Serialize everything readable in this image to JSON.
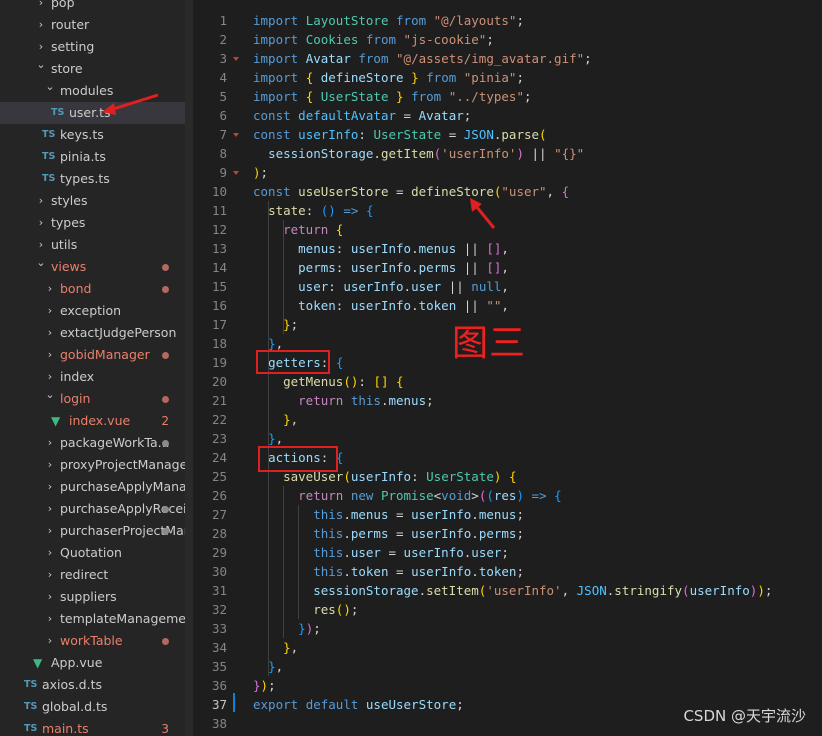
{
  "explorer": {
    "items": [
      {
        "label": "pop",
        "expanded": false,
        "icon": "folder",
        "status": ""
      },
      {
        "label": "router",
        "expanded": false,
        "icon": "folder",
        "status": ""
      },
      {
        "label": "setting",
        "expanded": false,
        "icon": "folder",
        "status": ""
      },
      {
        "label": "store",
        "expanded": true,
        "icon": "folder",
        "status": ""
      },
      {
        "label": "modules",
        "expanded": true,
        "icon": "folder",
        "status": ""
      },
      {
        "label": "user.ts",
        "icon": "ts",
        "badge": "TS",
        "status": "",
        "selected": true
      },
      {
        "label": "keys.ts",
        "icon": "ts",
        "badge": "TS",
        "status": ""
      },
      {
        "label": "pinia.ts",
        "icon": "ts",
        "badge": "TS",
        "status": ""
      },
      {
        "label": "types.ts",
        "icon": "ts",
        "badge": "TS",
        "status": ""
      },
      {
        "label": "styles",
        "expanded": false,
        "icon": "folder",
        "status": ""
      },
      {
        "label": "types",
        "expanded": false,
        "icon": "folder",
        "status": ""
      },
      {
        "label": "utils",
        "expanded": false,
        "icon": "folder",
        "status": ""
      },
      {
        "label": "views",
        "expanded": true,
        "icon": "folder",
        "status": "modified"
      },
      {
        "label": "bond",
        "expanded": false,
        "icon": "folder",
        "status": "modified"
      },
      {
        "label": "exception",
        "expanded": false,
        "icon": "folder",
        "status": ""
      },
      {
        "label": "extactJudgePerson",
        "expanded": false,
        "icon": "folder",
        "status": ""
      },
      {
        "label": "gobidManager",
        "expanded": false,
        "icon": "folder",
        "status": "modified"
      },
      {
        "label": "index",
        "expanded": false,
        "icon": "folder",
        "status": ""
      },
      {
        "label": "login",
        "expanded": true,
        "icon": "folder",
        "status": "modified"
      },
      {
        "label": "index.vue",
        "icon": "vue",
        "status": "error",
        "count": "2"
      },
      {
        "label": "packageWorkTa...",
        "expanded": false,
        "icon": "folder",
        "status": "dot-gray"
      },
      {
        "label": "proxyProjectManage",
        "expanded": false,
        "icon": "folder",
        "status": ""
      },
      {
        "label": "purchaseApplyManage",
        "expanded": false,
        "icon": "folder",
        "status": ""
      },
      {
        "label": "purchaseApplyReceiv...",
        "expanded": false,
        "icon": "folder",
        "status": "dot-gray"
      },
      {
        "label": "purchaserProjectMan...",
        "expanded": false,
        "icon": "folder",
        "status": "dot-gray"
      },
      {
        "label": "Quotation",
        "expanded": false,
        "icon": "folder",
        "status": ""
      },
      {
        "label": "redirect",
        "expanded": false,
        "icon": "folder",
        "status": ""
      },
      {
        "label": "suppliers",
        "expanded": false,
        "icon": "folder",
        "status": ""
      },
      {
        "label": "templateManagement",
        "expanded": false,
        "icon": "folder",
        "status": ""
      },
      {
        "label": "workTable",
        "expanded": false,
        "icon": "folder",
        "status": "modified"
      },
      {
        "label": "App.vue",
        "icon": "vue",
        "status": ""
      },
      {
        "label": "axios.d.ts",
        "icon": "ts",
        "badge": "TS",
        "status": ""
      },
      {
        "label": "global.d.ts",
        "icon": "ts",
        "badge": "TS",
        "status": ""
      },
      {
        "label": "main.ts",
        "icon": "ts",
        "badge": "TS",
        "status": "error",
        "count": "3"
      }
    ]
  },
  "editor": {
    "active_line": "37",
    "line_numbers": [
      "1",
      "2",
      "3",
      "4",
      "5",
      "6",
      "7",
      "8",
      "9",
      "10",
      "11",
      "12",
      "13",
      "14",
      "15",
      "16",
      "17",
      "18",
      "19",
      "20",
      "21",
      "22",
      "23",
      "24",
      "25",
      "26",
      "27",
      "28",
      "29",
      "30",
      "31",
      "32",
      "33",
      "34",
      "35",
      "36",
      "37",
      "38"
    ],
    "lines": [
      [
        [
          "k",
          "import"
        ],
        [
          "p",
          " "
        ],
        [
          "t",
          "LayoutStore"
        ],
        [
          "p",
          " "
        ],
        [
          "k",
          "from"
        ],
        [
          "p",
          " "
        ],
        [
          "s",
          "\"@/layouts\""
        ],
        [
          "p",
          ";"
        ]
      ],
      [
        [
          "k",
          "import"
        ],
        [
          "p",
          " "
        ],
        [
          "t",
          "Cookies"
        ],
        [
          "p",
          " "
        ],
        [
          "k",
          "from"
        ],
        [
          "p",
          " "
        ],
        [
          "s",
          "\"js-cookie\""
        ],
        [
          "p",
          ";"
        ]
      ],
      [
        [
          "k",
          "import"
        ],
        [
          "p",
          " "
        ],
        [
          "v",
          "Avatar"
        ],
        [
          "p",
          " "
        ],
        [
          "k",
          "from"
        ],
        [
          "p",
          " "
        ],
        [
          "s",
          "\"@/assets/img_avatar.gif\""
        ],
        [
          "p",
          ";"
        ]
      ],
      [
        [
          "k",
          "import"
        ],
        [
          "p",
          " "
        ],
        [
          "b1",
          "{"
        ],
        [
          "p",
          " "
        ],
        [
          "v",
          "defineStore"
        ],
        [
          "p",
          " "
        ],
        [
          "b1",
          "}"
        ],
        [
          "p",
          " "
        ],
        [
          "k",
          "from"
        ],
        [
          "p",
          " "
        ],
        [
          "s",
          "\"pinia\""
        ],
        [
          "p",
          ";"
        ]
      ],
      [
        [
          "k",
          "import"
        ],
        [
          "p",
          " "
        ],
        [
          "b1",
          "{"
        ],
        [
          "p",
          " "
        ],
        [
          "t",
          "UserState"
        ],
        [
          "p",
          " "
        ],
        [
          "b1",
          "}"
        ],
        [
          "p",
          " "
        ],
        [
          "k",
          "from"
        ],
        [
          "p",
          " "
        ],
        [
          "s",
          "\"../types\""
        ],
        [
          "p",
          ";"
        ]
      ],
      [
        [
          "k",
          "const"
        ],
        [
          "p",
          " "
        ],
        [
          "n",
          "defaultAvatar"
        ],
        [
          "p",
          " = "
        ],
        [
          "v",
          "Avatar"
        ],
        [
          "p",
          ";"
        ]
      ],
      [
        [
          "k",
          "const"
        ],
        [
          "p",
          " "
        ],
        [
          "n",
          "userInfo"
        ],
        [
          "p",
          ": "
        ],
        [
          "t",
          "UserState"
        ],
        [
          "p",
          " = "
        ],
        [
          "n",
          "JSON"
        ],
        [
          "p",
          "."
        ],
        [
          "f",
          "parse"
        ],
        [
          "b1",
          "("
        ]
      ],
      [
        [
          "p",
          "  "
        ],
        [
          "v",
          "sessionStorage"
        ],
        [
          "p",
          "."
        ],
        [
          "f",
          "getItem"
        ],
        [
          "b2",
          "("
        ],
        [
          "s",
          "'userInfo'"
        ],
        [
          "b2",
          ")"
        ],
        [
          "p",
          " || "
        ],
        [
          "s",
          "\"{}\""
        ]
      ],
      [
        [
          "b1",
          ")"
        ],
        [
          "p",
          ";"
        ]
      ],
      [
        [
          "k",
          "const"
        ],
        [
          "p",
          " "
        ],
        [
          "f",
          "useUserStore"
        ],
        [
          "p",
          " = "
        ],
        [
          "f",
          "defineStore"
        ],
        [
          "b1",
          "("
        ],
        [
          "s",
          "\"user\""
        ],
        [
          "p",
          ", "
        ],
        [
          "b2",
          "{"
        ]
      ],
      [
        [
          "p",
          "  "
        ],
        [
          "f",
          "state"
        ],
        [
          "p",
          ": "
        ],
        [
          "b3",
          "("
        ],
        [
          "b3",
          ")"
        ],
        [
          "p",
          " "
        ],
        [
          "k",
          "=>"
        ],
        [
          "p",
          " "
        ],
        [
          "b3",
          "{"
        ]
      ],
      [
        [
          "p",
          "    "
        ],
        [
          "ck",
          "return"
        ],
        [
          "p",
          " "
        ],
        [
          "b1",
          "{"
        ]
      ],
      [
        [
          "p",
          "      "
        ],
        [
          "v",
          "menus"
        ],
        [
          "p",
          ": "
        ],
        [
          "v",
          "userInfo"
        ],
        [
          "p",
          "."
        ],
        [
          "v",
          "menus"
        ],
        [
          "p",
          " || "
        ],
        [
          "b2",
          "[]"
        ],
        [
          "p",
          ","
        ]
      ],
      [
        [
          "p",
          "      "
        ],
        [
          "v",
          "perms"
        ],
        [
          "p",
          ": "
        ],
        [
          "v",
          "userInfo"
        ],
        [
          "p",
          "."
        ],
        [
          "v",
          "perms"
        ],
        [
          "p",
          " || "
        ],
        [
          "b2",
          "[]"
        ],
        [
          "p",
          ","
        ]
      ],
      [
        [
          "p",
          "      "
        ],
        [
          "v",
          "user"
        ],
        [
          "p",
          ": "
        ],
        [
          "v",
          "userInfo"
        ],
        [
          "p",
          "."
        ],
        [
          "v",
          "user"
        ],
        [
          "p",
          " || "
        ],
        [
          "k",
          "null"
        ],
        [
          "p",
          ","
        ]
      ],
      [
        [
          "p",
          "      "
        ],
        [
          "v",
          "token"
        ],
        [
          "p",
          ": "
        ],
        [
          "v",
          "userInfo"
        ],
        [
          "p",
          "."
        ],
        [
          "v",
          "token"
        ],
        [
          "p",
          " || "
        ],
        [
          "s",
          "\"\""
        ],
        [
          "p",
          ","
        ]
      ],
      [
        [
          "p",
          "    "
        ],
        [
          "b1",
          "}"
        ],
        [
          "p",
          ";"
        ]
      ],
      [
        [
          "p",
          "  "
        ],
        [
          "b3",
          "}"
        ],
        [
          "p",
          ","
        ]
      ],
      [
        [
          "p",
          "  "
        ],
        [
          "v",
          "getters"
        ],
        [
          "p",
          ": "
        ],
        [
          "b3",
          "{"
        ]
      ],
      [
        [
          "p",
          "    "
        ],
        [
          "f",
          "getMenus"
        ],
        [
          "b1",
          "("
        ],
        [
          "b1",
          ")"
        ],
        [
          "p",
          ": "
        ],
        [
          "b1",
          "[]"
        ],
        [
          "p",
          " "
        ],
        [
          "b1",
          "{"
        ]
      ],
      [
        [
          "p",
          "      "
        ],
        [
          "ck",
          "return"
        ],
        [
          "p",
          " "
        ],
        [
          "k",
          "this"
        ],
        [
          "p",
          "."
        ],
        [
          "v",
          "menus"
        ],
        [
          "p",
          ";"
        ]
      ],
      [
        [
          "p",
          "    "
        ],
        [
          "b1",
          "}"
        ],
        [
          "p",
          ","
        ]
      ],
      [
        [
          "p",
          "  "
        ],
        [
          "b3",
          "}"
        ],
        [
          "p",
          ","
        ]
      ],
      [
        [
          "p",
          "  "
        ],
        [
          "v",
          "actions"
        ],
        [
          "p",
          ": "
        ],
        [
          "b3",
          "{"
        ]
      ],
      [
        [
          "p",
          "    "
        ],
        [
          "f",
          "saveUser"
        ],
        [
          "b1",
          "("
        ],
        [
          "v",
          "userInfo"
        ],
        [
          "p",
          ": "
        ],
        [
          "t",
          "UserState"
        ],
        [
          "b1",
          ")"
        ],
        [
          "p",
          " "
        ],
        [
          "b1",
          "{"
        ]
      ],
      [
        [
          "p",
          "      "
        ],
        [
          "ck",
          "return"
        ],
        [
          "p",
          " "
        ],
        [
          "k",
          "new"
        ],
        [
          "p",
          " "
        ],
        [
          "t",
          "Promise"
        ],
        [
          "p",
          "<"
        ],
        [
          "k",
          "void"
        ],
        [
          "p",
          ">"
        ],
        [
          "b2",
          "("
        ],
        [
          "b3",
          "("
        ],
        [
          "v",
          "res"
        ],
        [
          "b3",
          ")"
        ],
        [
          "p",
          " "
        ],
        [
          "k",
          "=>"
        ],
        [
          "p",
          " "
        ],
        [
          "b3",
          "{"
        ]
      ],
      [
        [
          "p",
          "        "
        ],
        [
          "k",
          "this"
        ],
        [
          "p",
          "."
        ],
        [
          "v",
          "menus"
        ],
        [
          "p",
          " = "
        ],
        [
          "v",
          "userInfo"
        ],
        [
          "p",
          "."
        ],
        [
          "v",
          "menus"
        ],
        [
          "p",
          ";"
        ]
      ],
      [
        [
          "p",
          "        "
        ],
        [
          "k",
          "this"
        ],
        [
          "p",
          "."
        ],
        [
          "v",
          "perms"
        ],
        [
          "p",
          " = "
        ],
        [
          "v",
          "userInfo"
        ],
        [
          "p",
          "."
        ],
        [
          "v",
          "perms"
        ],
        [
          "p",
          ";"
        ]
      ],
      [
        [
          "p",
          "        "
        ],
        [
          "k",
          "this"
        ],
        [
          "p",
          "."
        ],
        [
          "v",
          "user"
        ],
        [
          "p",
          " = "
        ],
        [
          "v",
          "userInfo"
        ],
        [
          "p",
          "."
        ],
        [
          "v",
          "user"
        ],
        [
          "p",
          ";"
        ]
      ],
      [
        [
          "p",
          "        "
        ],
        [
          "k",
          "this"
        ],
        [
          "p",
          "."
        ],
        [
          "v",
          "token"
        ],
        [
          "p",
          " = "
        ],
        [
          "v",
          "userInfo"
        ],
        [
          "p",
          "."
        ],
        [
          "v",
          "token"
        ],
        [
          "p",
          ";"
        ]
      ],
      [
        [
          "p",
          "        "
        ],
        [
          "v",
          "sessionStorage"
        ],
        [
          "p",
          "."
        ],
        [
          "f",
          "setItem"
        ],
        [
          "b1",
          "("
        ],
        [
          "s",
          "'userInfo'"
        ],
        [
          "p",
          ", "
        ],
        [
          "n",
          "JSON"
        ],
        [
          "p",
          "."
        ],
        [
          "f",
          "stringify"
        ],
        [
          "b2",
          "("
        ],
        [
          "v",
          "userInfo"
        ],
        [
          "b2",
          ")"
        ],
        [
          "b1",
          ")"
        ],
        [
          "p",
          ";"
        ]
      ],
      [
        [
          "p",
          "        "
        ],
        [
          "f",
          "res"
        ],
        [
          "b1",
          "("
        ],
        [
          "b1",
          ")"
        ],
        [
          "p",
          ";"
        ]
      ],
      [
        [
          "p",
          "      "
        ],
        [
          "b3",
          "}"
        ],
        [
          "b2",
          ")"
        ],
        [
          "p",
          ";"
        ]
      ],
      [
        [
          "p",
          "    "
        ],
        [
          "b1",
          "}"
        ],
        [
          "p",
          ","
        ]
      ],
      [
        [
          "p",
          "  "
        ],
        [
          "b3",
          "}"
        ],
        [
          "p",
          ","
        ]
      ],
      [
        [
          "b2",
          "}"
        ],
        [
          "b1",
          ")"
        ],
        [
          "p",
          ";"
        ]
      ],
      [
        [
          "k",
          "export"
        ],
        [
          "p",
          " "
        ],
        [
          "k",
          "default"
        ],
        [
          "p",
          " "
        ],
        [
          "v",
          "useUserStore"
        ],
        [
          "p",
          ";"
        ]
      ],
      [
        [
          "p",
          ""
        ]
      ]
    ]
  },
  "annotations": {
    "figure_label": "图三",
    "highlight_getters": "getters",
    "highlight_actions": "actions"
  },
  "watermark": "CSDN @天宇流沙",
  "colors": {
    "keyword": "#569cd6",
    "control": "#c586c0",
    "string": "#ce9178",
    "variable": "#9cdcfe",
    "function": "#dcdcaa",
    "type": "#4ec9b0",
    "annotation_red": "#e02020"
  }
}
